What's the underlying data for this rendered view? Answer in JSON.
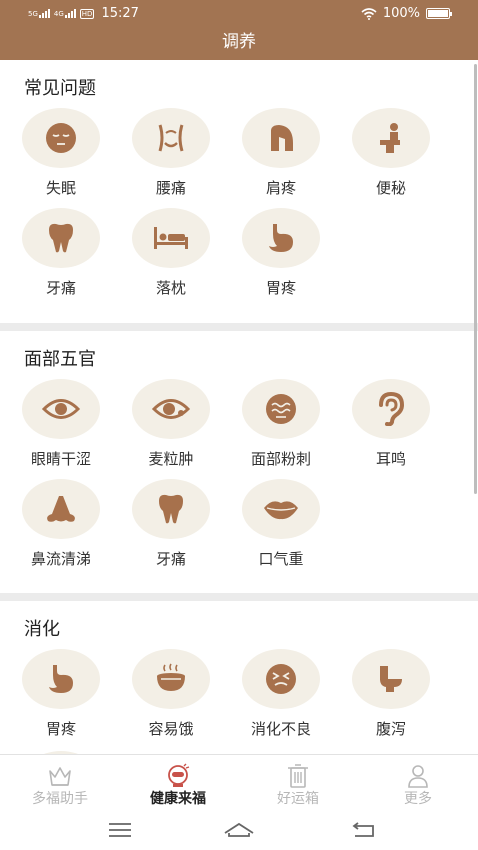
{
  "status_bar": {
    "net1": "5G",
    "net2": "4G",
    "hd": "HD",
    "time": "15:27",
    "battery": "100%",
    "battery_level": 1.0
  },
  "header": {
    "title": "调养"
  },
  "sections": [
    {
      "title": "常见问题",
      "items": [
        {
          "label": "失眠",
          "icon": "sleepy-face-icon"
        },
        {
          "label": "腰痛",
          "icon": "waist-icon"
        },
        {
          "label": "肩疼",
          "icon": "shoulder-icon"
        },
        {
          "label": "便秘",
          "icon": "toilet-person-icon"
        },
        {
          "label": "牙痛",
          "icon": "tooth-icon"
        },
        {
          "label": "落枕",
          "icon": "bed-icon"
        },
        {
          "label": "胃疼",
          "icon": "stomach-icon"
        }
      ]
    },
    {
      "title": "面部五官",
      "items": [
        {
          "label": "眼睛干涩",
          "icon": "eye-icon"
        },
        {
          "label": "麦粒肿",
          "icon": "eye-sty-icon"
        },
        {
          "label": "面部粉刺",
          "icon": "face-acne-icon"
        },
        {
          "label": "耳鸣",
          "icon": "ear-icon"
        },
        {
          "label": "鼻流清涕",
          "icon": "nose-icon"
        },
        {
          "label": "牙痛",
          "icon": "tooth-icon"
        },
        {
          "label": "口气重",
          "icon": "lips-icon"
        }
      ]
    },
    {
      "title": "消化",
      "items": [
        {
          "label": "胃疼",
          "icon": "stomach-icon"
        },
        {
          "label": "容易饿",
          "icon": "food-bowl-icon"
        },
        {
          "label": "消化不良",
          "icon": "dizzy-face-icon"
        },
        {
          "label": "腹泻",
          "icon": "toilet-icon"
        }
      ]
    }
  ],
  "tabbar": {
    "tabs": [
      {
        "label": "多福助手",
        "icon": "crown-icon",
        "active": false
      },
      {
        "label": "健康来福",
        "icon": "health-robot-icon",
        "active": true
      },
      {
        "label": "好运箱",
        "icon": "trash-box-icon",
        "active": false
      },
      {
        "label": "更多",
        "icon": "person-icon",
        "active": false
      }
    ]
  },
  "navbar": {
    "buttons": [
      "menu-icon",
      "home-icon",
      "back-icon"
    ]
  },
  "colors": {
    "brand": "#a27452",
    "icon": "#a7714c",
    "icon_bg": "#f3efe6",
    "active_tab": "#c8524a"
  }
}
